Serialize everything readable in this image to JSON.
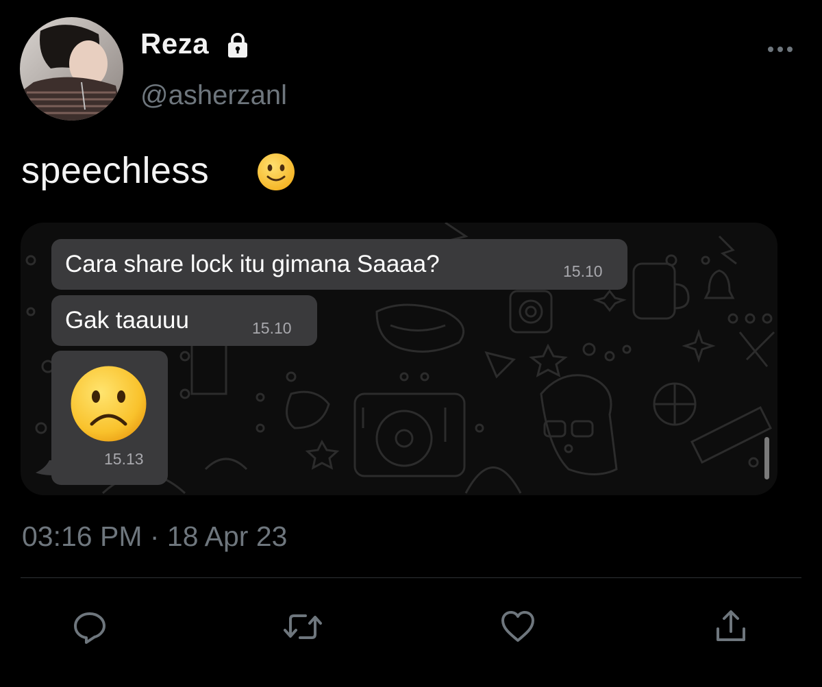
{
  "tweet": {
    "author": {
      "display_name": "Reza",
      "handle": "@asherzanl",
      "protected_icon": "lock-icon",
      "avatar": "profile-photo"
    },
    "menu_icon": "more-horizontal-icon",
    "text": "speechless",
    "text_emoji": "slightly-smiling-face",
    "timestamp": "03:16 PM · 18 Apr 23"
  },
  "attachment": {
    "type": "chat-screenshot",
    "messages": [
      {
        "text": "Cara share lock itu gimana Saaaa?",
        "time": "15.10"
      },
      {
        "text": "Gak taauuu",
        "time": "15.10"
      },
      {
        "emoji": "frowning-face",
        "time": "15.13"
      }
    ]
  },
  "actions": [
    {
      "icon": "reply-icon"
    },
    {
      "icon": "retweet-icon"
    },
    {
      "icon": "like-icon"
    },
    {
      "icon": "share-icon"
    }
  ],
  "colors": {
    "background": "#000000",
    "muted_text": "#6e767d",
    "bubble": "#3a3a3c",
    "divider": "#2f3336"
  }
}
